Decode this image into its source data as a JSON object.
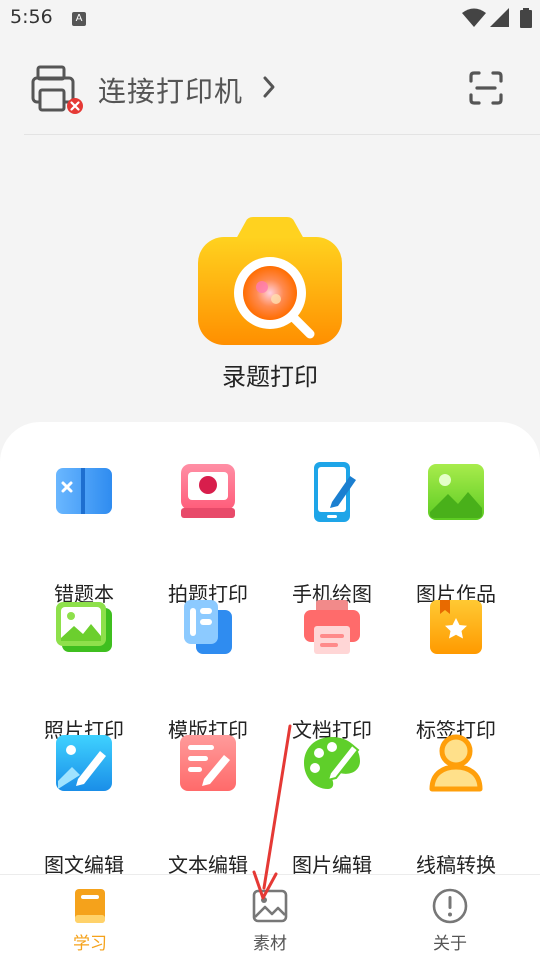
{
  "status_bar": {
    "time": "5:56",
    "notification_letter": "A"
  },
  "header": {
    "printer_label": "连接打印机"
  },
  "hero": {
    "label": "录题打印"
  },
  "grid": {
    "items": [
      {
        "label": "错题本",
        "icon": "book-icon"
      },
      {
        "label": "拍题打印",
        "icon": "photo-print-icon"
      },
      {
        "label": "手机绘图",
        "icon": "phone-draw-icon"
      },
      {
        "label": "图片作品",
        "icon": "image-icon"
      },
      {
        "label": "照片打印",
        "icon": "photo-icon"
      },
      {
        "label": "模版打印",
        "icon": "template-icon"
      },
      {
        "label": "文档打印",
        "icon": "document-print-icon"
      },
      {
        "label": "标签打印",
        "icon": "label-icon"
      },
      {
        "label": "图文编辑",
        "icon": "image-text-edit-icon"
      },
      {
        "label": "文本编辑",
        "icon": "text-edit-icon"
      },
      {
        "label": "图片编辑",
        "icon": "palette-icon"
      },
      {
        "label": "线稿转换",
        "icon": "person-icon"
      }
    ]
  },
  "bottom_nav": {
    "items": [
      {
        "label": "学习",
        "icon": "study-book-icon",
        "active": true
      },
      {
        "label": "素材",
        "icon": "material-image-icon",
        "active": false
      },
      {
        "label": "关于",
        "icon": "info-icon",
        "active": false
      }
    ]
  },
  "colors": {
    "accent": "#f5a21b",
    "background": "#f4f4f4",
    "card": "#ffffff"
  }
}
